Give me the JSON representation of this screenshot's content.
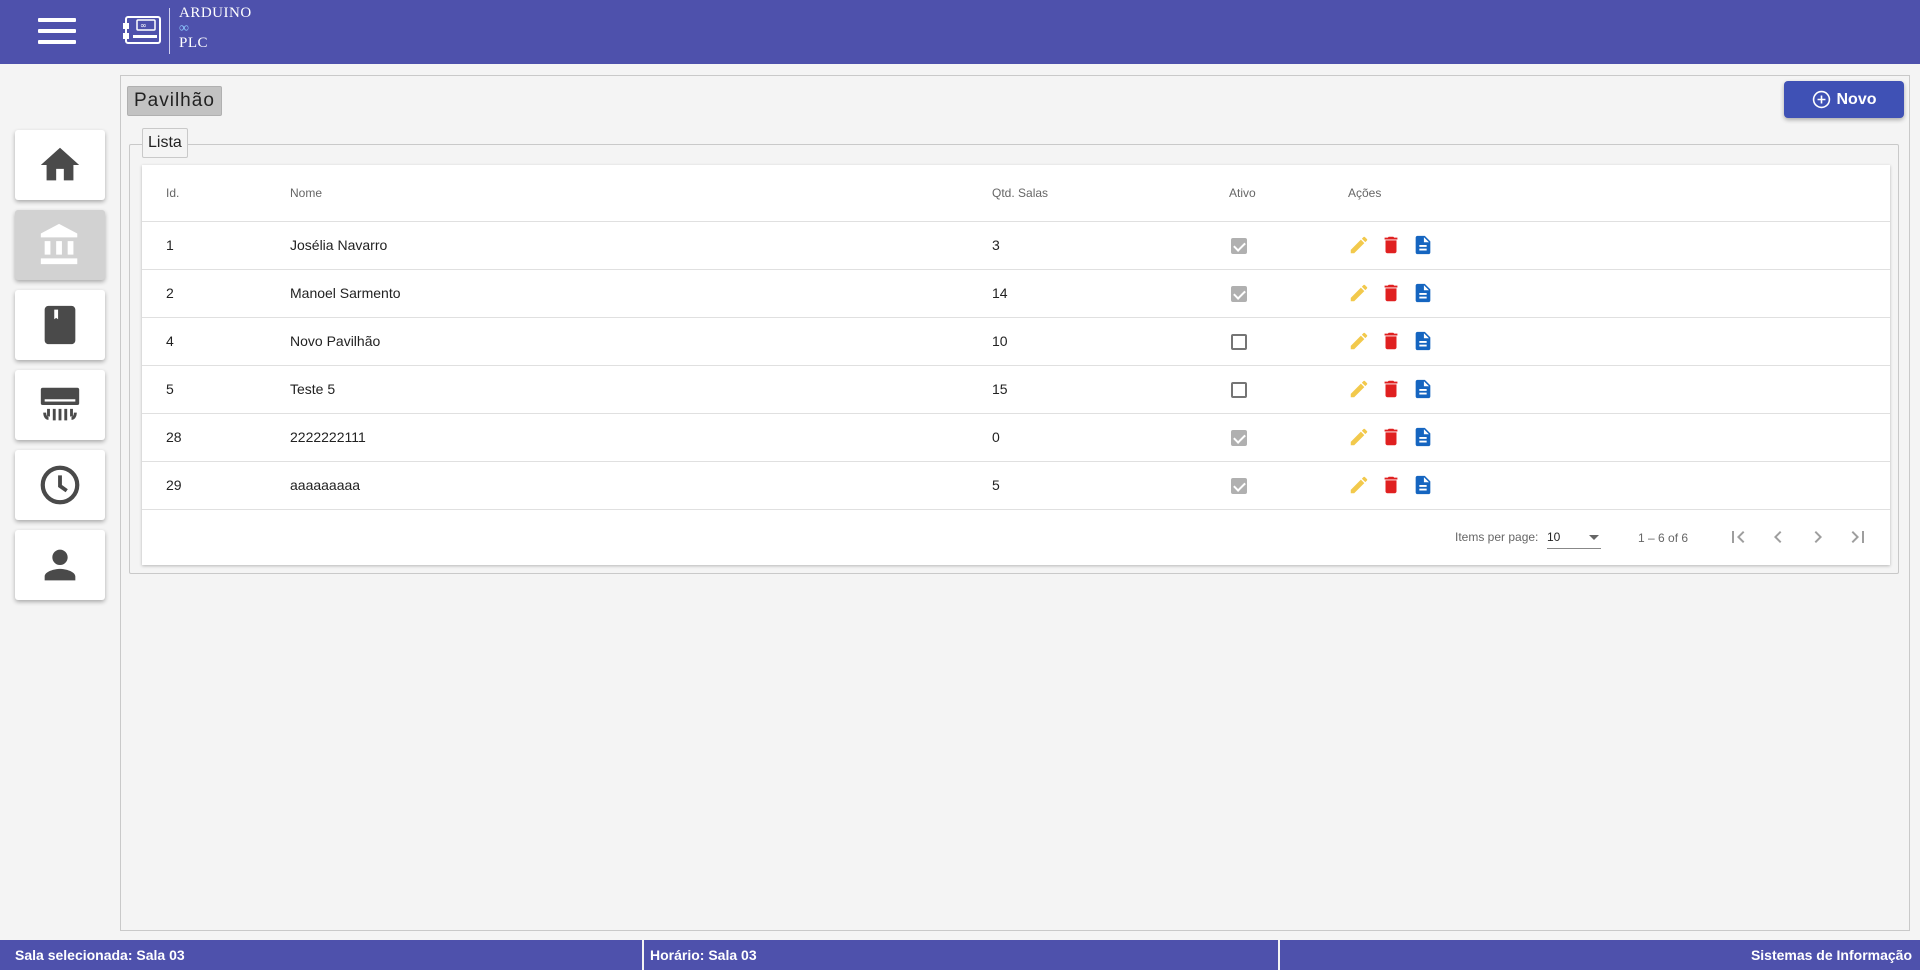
{
  "app": {
    "logo_line1": "ARDUINO",
    "logo_line2": "∞",
    "logo_line3": "PLC"
  },
  "colors": {
    "primary": "#4e51ac",
    "button": "#3f51b5",
    "edit": "#f2c94c",
    "delete": "#e02020",
    "doc": "#1565c0"
  },
  "sidebar": {
    "items": [
      {
        "icon": "home-icon",
        "active": false
      },
      {
        "icon": "building-icon",
        "active": true
      },
      {
        "icon": "book-icon",
        "active": false
      },
      {
        "icon": "air-conditioner-icon",
        "active": false
      },
      {
        "icon": "clock-icon",
        "active": false
      },
      {
        "icon": "user-icon",
        "active": false
      }
    ]
  },
  "page": {
    "title": "Pavilhão",
    "new_button": "Novo",
    "section": "Lista"
  },
  "table": {
    "headers": {
      "id": "Id.",
      "nome": "Nome",
      "qtd": "Qtd. Salas",
      "ativo": "Ativo",
      "acoes": "Ações"
    },
    "rows": [
      {
        "id": "1",
        "nome": "Josélia Navarro",
        "qtd": "3",
        "ativo": true
      },
      {
        "id": "2",
        "nome": "Manoel Sarmento",
        "qtd": "14",
        "ativo": true
      },
      {
        "id": "4",
        "nome": "Novo Pavilhão",
        "qtd": "10",
        "ativo": false
      },
      {
        "id": "5",
        "nome": "Teste 5",
        "qtd": "15",
        "ativo": false
      },
      {
        "id": "28",
        "nome": "2222222111",
        "qtd": "0",
        "ativo": true
      },
      {
        "id": "29",
        "nome": "aaaaaaaaa",
        "qtd": "5",
        "ativo": true
      }
    ]
  },
  "paginator": {
    "label": "Items per page:",
    "page_size": "10",
    "range": "1 – 6 of 6"
  },
  "status": {
    "sala": "Sala selecionada: Sala 03",
    "horario": "Horário: Sala 03",
    "footer": "Sistemas de Informação"
  }
}
